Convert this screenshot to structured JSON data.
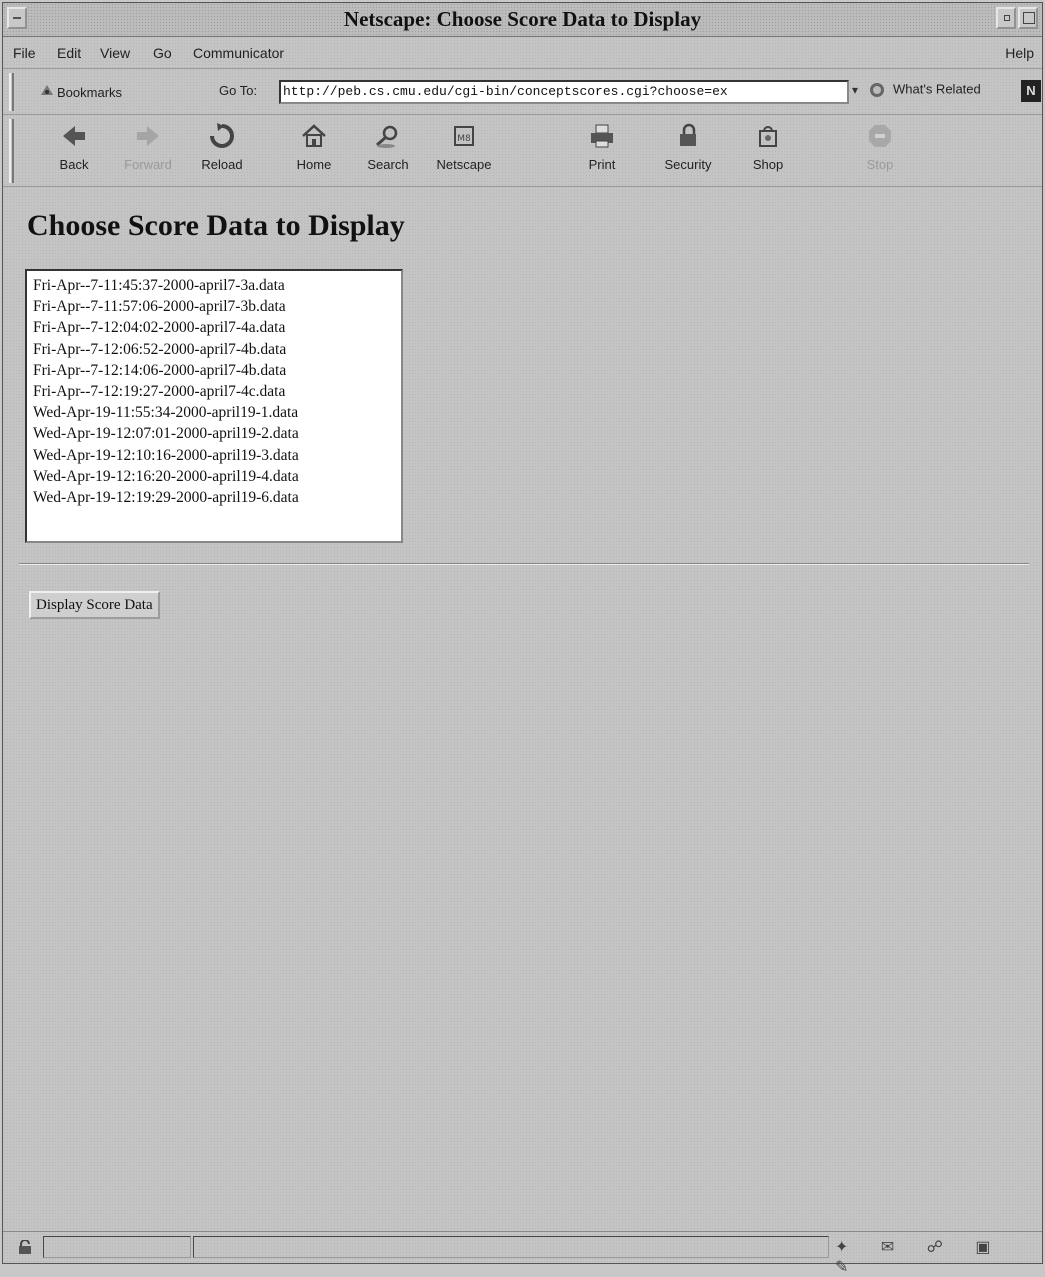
{
  "window": {
    "title": "Netscape: Choose Score Data to Display"
  },
  "menu": {
    "file": "File",
    "edit": "Edit",
    "view": "View",
    "go": "Go",
    "communicator": "Communicator",
    "help": "Help"
  },
  "location": {
    "bookmarks_label": "Bookmarks",
    "goto_label": "Go To:",
    "url": "http://peb.cs.cmu.edu/cgi-bin/conceptscores.cgi?choose=ex",
    "whats_related_label": "What's Related",
    "netscape_logo": "N"
  },
  "nav": {
    "back": "Back",
    "forward": "Forward",
    "reload": "Reload",
    "home": "Home",
    "search": "Search",
    "netscape": "Netscape",
    "print": "Print",
    "security": "Security",
    "shop": "Shop",
    "stop": "Stop"
  },
  "page": {
    "heading": "Choose Score Data to Display",
    "files": [
      "Fri-Apr--7-11:45:37-2000-april7-3a.data",
      "Fri-Apr--7-11:57:06-2000-april7-3b.data",
      "Fri-Apr--7-12:04:02-2000-april7-4a.data",
      "Fri-Apr--7-12:06:52-2000-april7-4b.data",
      "Fri-Apr--7-12:14:06-2000-april7-4b.data",
      "Fri-Apr--7-12:19:27-2000-april7-4c.data",
      "Wed-Apr-19-11:55:34-2000-april19-1.data",
      "Wed-Apr-19-12:07:01-2000-april19-2.data",
      "Wed-Apr-19-12:10:16-2000-april19-3.data",
      "Wed-Apr-19-12:16:20-2000-april19-4.data",
      "Wed-Apr-19-12:19:29-2000-april19-6.data"
    ],
    "submit_label": "Display Score Data"
  },
  "icons": {
    "system_menu": "system-menu-icon",
    "minimize": "minimize-icon",
    "maximize": "maximize-icon",
    "bookmarks": "bookmarks-icon",
    "whats_related": "whats-related-icon",
    "security_lock": "lock-icon",
    "component_bar": [
      "component-navigator-icon",
      "mail-icon",
      "discussion-icon",
      "composer-icon",
      "pen-icon"
    ]
  }
}
